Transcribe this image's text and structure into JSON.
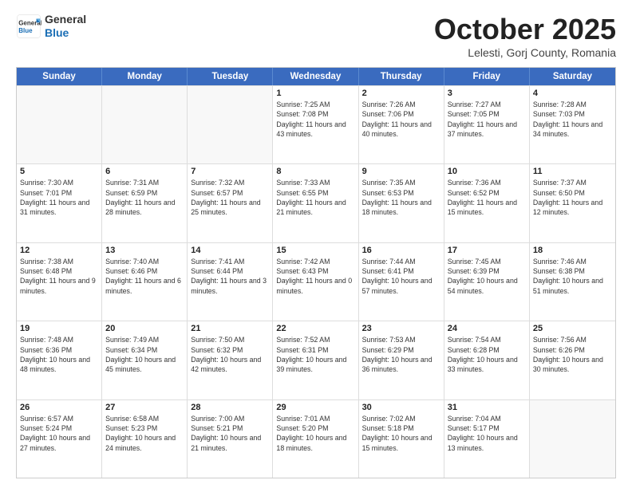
{
  "header": {
    "logo_general": "General",
    "logo_blue": "Blue",
    "month_title": "October 2025",
    "location": "Lelesti, Gorj County, Romania"
  },
  "days_of_week": [
    "Sunday",
    "Monday",
    "Tuesday",
    "Wednesday",
    "Thursday",
    "Friday",
    "Saturday"
  ],
  "weeks": [
    [
      {
        "date": "",
        "sunrise": "",
        "sunset": "",
        "daylight": ""
      },
      {
        "date": "",
        "sunrise": "",
        "sunset": "",
        "daylight": ""
      },
      {
        "date": "",
        "sunrise": "",
        "sunset": "",
        "daylight": ""
      },
      {
        "date": "1",
        "sunrise": "Sunrise: 7:25 AM",
        "sunset": "Sunset: 7:08 PM",
        "daylight": "Daylight: 11 hours and 43 minutes."
      },
      {
        "date": "2",
        "sunrise": "Sunrise: 7:26 AM",
        "sunset": "Sunset: 7:06 PM",
        "daylight": "Daylight: 11 hours and 40 minutes."
      },
      {
        "date": "3",
        "sunrise": "Sunrise: 7:27 AM",
        "sunset": "Sunset: 7:05 PM",
        "daylight": "Daylight: 11 hours and 37 minutes."
      },
      {
        "date": "4",
        "sunrise": "Sunrise: 7:28 AM",
        "sunset": "Sunset: 7:03 PM",
        "daylight": "Daylight: 11 hours and 34 minutes."
      }
    ],
    [
      {
        "date": "5",
        "sunrise": "Sunrise: 7:30 AM",
        "sunset": "Sunset: 7:01 PM",
        "daylight": "Daylight: 11 hours and 31 minutes."
      },
      {
        "date": "6",
        "sunrise": "Sunrise: 7:31 AM",
        "sunset": "Sunset: 6:59 PM",
        "daylight": "Daylight: 11 hours and 28 minutes."
      },
      {
        "date": "7",
        "sunrise": "Sunrise: 7:32 AM",
        "sunset": "Sunset: 6:57 PM",
        "daylight": "Daylight: 11 hours and 25 minutes."
      },
      {
        "date": "8",
        "sunrise": "Sunrise: 7:33 AM",
        "sunset": "Sunset: 6:55 PM",
        "daylight": "Daylight: 11 hours and 21 minutes."
      },
      {
        "date": "9",
        "sunrise": "Sunrise: 7:35 AM",
        "sunset": "Sunset: 6:53 PM",
        "daylight": "Daylight: 11 hours and 18 minutes."
      },
      {
        "date": "10",
        "sunrise": "Sunrise: 7:36 AM",
        "sunset": "Sunset: 6:52 PM",
        "daylight": "Daylight: 11 hours and 15 minutes."
      },
      {
        "date": "11",
        "sunrise": "Sunrise: 7:37 AM",
        "sunset": "Sunset: 6:50 PM",
        "daylight": "Daylight: 11 hours and 12 minutes."
      }
    ],
    [
      {
        "date": "12",
        "sunrise": "Sunrise: 7:38 AM",
        "sunset": "Sunset: 6:48 PM",
        "daylight": "Daylight: 11 hours and 9 minutes."
      },
      {
        "date": "13",
        "sunrise": "Sunrise: 7:40 AM",
        "sunset": "Sunset: 6:46 PM",
        "daylight": "Daylight: 11 hours and 6 minutes."
      },
      {
        "date": "14",
        "sunrise": "Sunrise: 7:41 AM",
        "sunset": "Sunset: 6:44 PM",
        "daylight": "Daylight: 11 hours and 3 minutes."
      },
      {
        "date": "15",
        "sunrise": "Sunrise: 7:42 AM",
        "sunset": "Sunset: 6:43 PM",
        "daylight": "Daylight: 11 hours and 0 minutes."
      },
      {
        "date": "16",
        "sunrise": "Sunrise: 7:44 AM",
        "sunset": "Sunset: 6:41 PM",
        "daylight": "Daylight: 10 hours and 57 minutes."
      },
      {
        "date": "17",
        "sunrise": "Sunrise: 7:45 AM",
        "sunset": "Sunset: 6:39 PM",
        "daylight": "Daylight: 10 hours and 54 minutes."
      },
      {
        "date": "18",
        "sunrise": "Sunrise: 7:46 AM",
        "sunset": "Sunset: 6:38 PM",
        "daylight": "Daylight: 10 hours and 51 minutes."
      }
    ],
    [
      {
        "date": "19",
        "sunrise": "Sunrise: 7:48 AM",
        "sunset": "Sunset: 6:36 PM",
        "daylight": "Daylight: 10 hours and 48 minutes."
      },
      {
        "date": "20",
        "sunrise": "Sunrise: 7:49 AM",
        "sunset": "Sunset: 6:34 PM",
        "daylight": "Daylight: 10 hours and 45 minutes."
      },
      {
        "date": "21",
        "sunrise": "Sunrise: 7:50 AM",
        "sunset": "Sunset: 6:32 PM",
        "daylight": "Daylight: 10 hours and 42 minutes."
      },
      {
        "date": "22",
        "sunrise": "Sunrise: 7:52 AM",
        "sunset": "Sunset: 6:31 PM",
        "daylight": "Daylight: 10 hours and 39 minutes."
      },
      {
        "date": "23",
        "sunrise": "Sunrise: 7:53 AM",
        "sunset": "Sunset: 6:29 PM",
        "daylight": "Daylight: 10 hours and 36 minutes."
      },
      {
        "date": "24",
        "sunrise": "Sunrise: 7:54 AM",
        "sunset": "Sunset: 6:28 PM",
        "daylight": "Daylight: 10 hours and 33 minutes."
      },
      {
        "date": "25",
        "sunrise": "Sunrise: 7:56 AM",
        "sunset": "Sunset: 6:26 PM",
        "daylight": "Daylight: 10 hours and 30 minutes."
      }
    ],
    [
      {
        "date": "26",
        "sunrise": "Sunrise: 6:57 AM",
        "sunset": "Sunset: 5:24 PM",
        "daylight": "Daylight: 10 hours and 27 minutes."
      },
      {
        "date": "27",
        "sunrise": "Sunrise: 6:58 AM",
        "sunset": "Sunset: 5:23 PM",
        "daylight": "Daylight: 10 hours and 24 minutes."
      },
      {
        "date": "28",
        "sunrise": "Sunrise: 7:00 AM",
        "sunset": "Sunset: 5:21 PM",
        "daylight": "Daylight: 10 hours and 21 minutes."
      },
      {
        "date": "29",
        "sunrise": "Sunrise: 7:01 AM",
        "sunset": "Sunset: 5:20 PM",
        "daylight": "Daylight: 10 hours and 18 minutes."
      },
      {
        "date": "30",
        "sunrise": "Sunrise: 7:02 AM",
        "sunset": "Sunset: 5:18 PM",
        "daylight": "Daylight: 10 hours and 15 minutes."
      },
      {
        "date": "31",
        "sunrise": "Sunrise: 7:04 AM",
        "sunset": "Sunset: 5:17 PM",
        "daylight": "Daylight: 10 hours and 13 minutes."
      },
      {
        "date": "",
        "sunrise": "",
        "sunset": "",
        "daylight": ""
      }
    ]
  ]
}
